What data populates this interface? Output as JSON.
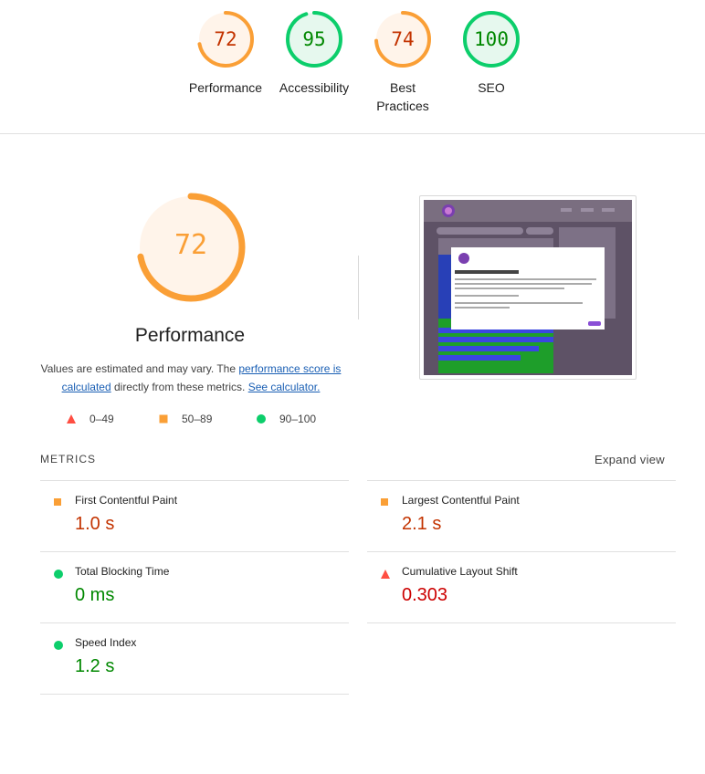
{
  "scores": [
    {
      "label": "Performance",
      "value": 72,
      "score": 0.72,
      "color": "#fa9f36",
      "bg": "#fff4ea",
      "text_color": "#c33300"
    },
    {
      "label": "Accessibility",
      "value": 95,
      "score": 0.95,
      "color": "#0cce6b",
      "bg": "#e6f8ee",
      "text_color": "#008800"
    },
    {
      "label": "Best Practices",
      "value": 74,
      "score": 0.74,
      "color": "#fa9f36",
      "bg": "#fff4ea",
      "text_color": "#c33300"
    },
    {
      "label": "SEO",
      "value": 100,
      "score": 1.0,
      "color": "#0cce6b",
      "bg": "#e6f8ee",
      "text_color": "#008800"
    }
  ],
  "performance": {
    "score": 72,
    "score_fraction": 0.72,
    "title": "Performance",
    "desc_prefix": "Values are estimated and may vary. The ",
    "link1": "performance score is calculated",
    "desc_middle": " directly from these metrics. ",
    "link2": "See calculator."
  },
  "legend": [
    {
      "icon": "triangle-red-icon",
      "range": "0–49"
    },
    {
      "icon": "square-orange-icon",
      "range": "50–89"
    },
    {
      "icon": "circle-green-icon",
      "range": "90–100"
    }
  ],
  "metrics_section": {
    "title": "METRICS",
    "expand": "Expand view"
  },
  "metrics": [
    {
      "name": "First Contentful Paint",
      "value": "1.0 s",
      "icon": "square-orange-icon",
      "color": "#c33300"
    },
    {
      "name": "Largest Contentful Paint",
      "value": "2.1 s",
      "icon": "square-orange-icon",
      "color": "#c33300"
    },
    {
      "name": "Total Blocking Time",
      "value": "0 ms",
      "icon": "circle-green-icon",
      "color": "#008800"
    },
    {
      "name": "Cumulative Layout Shift",
      "value": "0.303",
      "icon": "triangle-red-icon",
      "color": "#cc0000"
    },
    {
      "name": "Speed Index",
      "value": "1.2 s",
      "icon": "circle-green-icon",
      "color": "#008800"
    }
  ],
  "screenshot": {
    "modal_title": "Welcome to Out & About",
    "search_placeholder": "Search events"
  },
  "colors": {
    "orange": "#fa9f36",
    "green": "#0cce6b",
    "red": "#ff4e42",
    "link": "#1a5fb4"
  }
}
